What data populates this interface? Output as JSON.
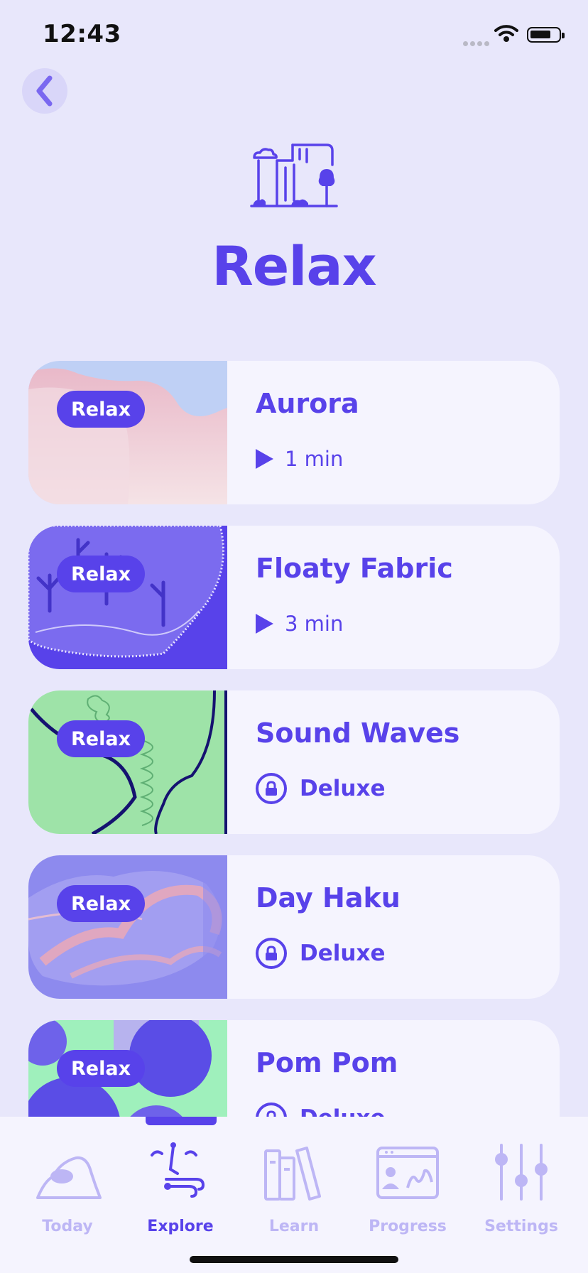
{
  "status_bar": {
    "time": "12:43"
  },
  "header": {
    "title": "Relax",
    "hero_icon": "waterfall-icon",
    "back_icon": "chevron-left-icon"
  },
  "items": [
    {
      "tag": "Relax",
      "title": "Aurora",
      "access": "play",
      "duration": "1 min"
    },
    {
      "tag": "Relax",
      "title": "Floaty Fabric",
      "access": "play",
      "duration": "3 min"
    },
    {
      "tag": "Relax",
      "title": "Sound Waves",
      "access": "locked",
      "badge": "Deluxe"
    },
    {
      "tag": "Relax",
      "title": "Day Haku",
      "access": "locked",
      "badge": "Deluxe"
    },
    {
      "tag": "Relax",
      "title": "Pom Pom",
      "access": "locked",
      "badge": "Deluxe"
    }
  ],
  "tab_bar": {
    "active": "Explore",
    "tabs": [
      {
        "label": "Today",
        "icon": "hills-icon"
      },
      {
        "label": "Explore",
        "icon": "explore-figure-icon"
      },
      {
        "label": "Learn",
        "icon": "books-icon"
      },
      {
        "label": "Progress",
        "icon": "progress-picture-icon"
      },
      {
        "label": "Settings",
        "icon": "sliders-icon"
      }
    ]
  },
  "colors": {
    "accent": "#5842EA",
    "background": "#E8E7FB",
    "card": "#F5F4FE",
    "inactive_tab": "#BDB6F5"
  }
}
